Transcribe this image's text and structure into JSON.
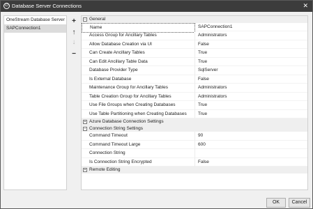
{
  "window": {
    "title": "Database Server Connections",
    "close_glyph": "✕"
  },
  "left_list": {
    "items": [
      {
        "label": "OneStream Database Server",
        "selected": false
      },
      {
        "label": "SAPConnection1",
        "selected": true
      }
    ]
  },
  "toolbar": {
    "add_glyph": "+",
    "up_glyph": "↑",
    "down_glyph": "↓",
    "remove_glyph": "−"
  },
  "categories": [
    {
      "label": "General",
      "toggle": "−",
      "rows": [
        {
          "name": "Name",
          "value": "SAPConnection1",
          "selected": true
        },
        {
          "name": "Access Group for Ancillary Tables",
          "value": "Administrators"
        },
        {
          "name": "Allow Database Creation via UI",
          "value": "False"
        },
        {
          "name": "Can Create Ancillary Tables",
          "value": "True"
        },
        {
          "name": "Can Edit Ancillary Table Data",
          "value": "True"
        },
        {
          "name": "Database Provider Type",
          "value": "SqlServer"
        },
        {
          "name": "Is External Database",
          "value": "False"
        },
        {
          "name": "Maintenance Group for Ancillary Tables",
          "value": "Administrators"
        },
        {
          "name": "Table Creation Group for Ancillary Tables",
          "value": "Administrators"
        },
        {
          "name": "Use File Groups when Creating Databases",
          "value": "True"
        },
        {
          "name": "Use Table Partitioning when Creating Databases",
          "value": "True"
        }
      ]
    },
    {
      "label": "Azure Database Connection Settings",
      "toggle": "+",
      "rows": []
    },
    {
      "label": "Connection String Settings",
      "toggle": "−",
      "rows": [
        {
          "name": "Command Timeout",
          "value": "90"
        },
        {
          "name": "Command Timeout Large",
          "value": "600"
        },
        {
          "name": "Connection String",
          "value": ""
        },
        {
          "name": "Is Connection String Encrypted",
          "value": "False"
        }
      ]
    },
    {
      "label": "Remote Editing",
      "toggle": "+",
      "rows": []
    }
  ],
  "footer": {
    "ok_label": "OK",
    "cancel_label": "Cancel"
  },
  "colors": {
    "titlebar": "#3c3c3c",
    "selection": "#dcdcdc",
    "category_bg": "#efefef"
  },
  "icons": {
    "app": "onestream-logo-icon",
    "close": "close-icon",
    "add": "add-icon",
    "up": "arrow-up-icon",
    "down": "arrow-down-icon",
    "remove": "remove-icon"
  }
}
